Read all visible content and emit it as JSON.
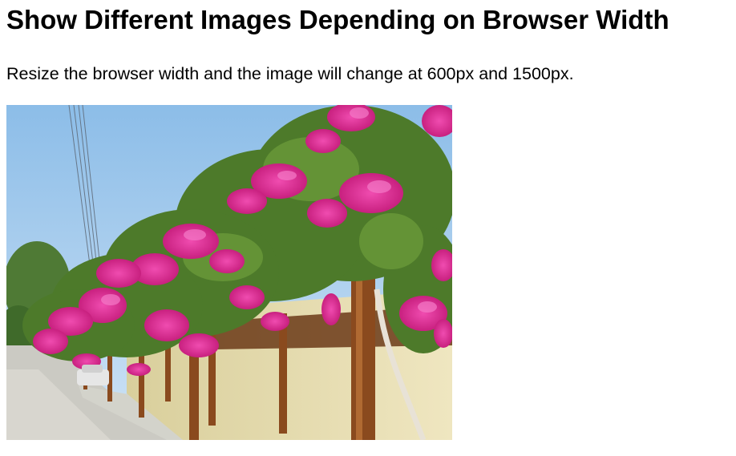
{
  "heading": "Show Different Images Depending on Browser Width",
  "paragraph": "Resize the browser width and the image will change at 600px and 1500px.",
  "image": {
    "subject": "bougainvillea-flowers-photo",
    "colors": {
      "sky": "#9cc8ee",
      "flowers": "#e0309a",
      "foliage": "#4d7a2a",
      "wall": "#e8dfb6",
      "beams": "#8a4a1e",
      "road": "#c9c9c4"
    }
  }
}
